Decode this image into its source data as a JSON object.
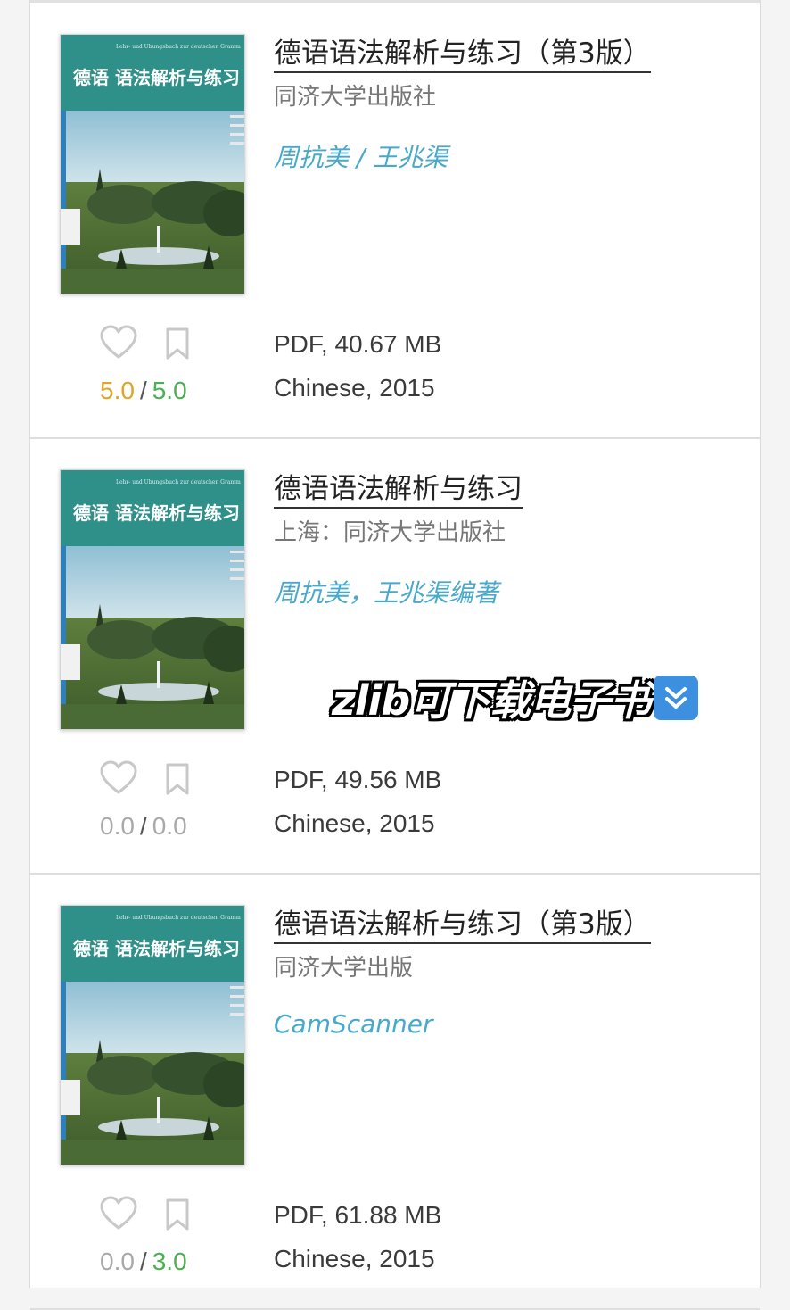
{
  "colors": {
    "author": "#49a9cb",
    "rating_high": "#e0a526",
    "rating_green": "#4caf50",
    "rating_zero": "#a9a9a9",
    "cover_teal": "#2e8f8a"
  },
  "icons": {
    "like": "heart-icon",
    "save": "bookmark-icon",
    "overlay": "double-down-arrow-icon"
  },
  "books": [
    {
      "title": "德语语法解析与练习（第3版）",
      "publisher": "同济大学出版社",
      "author": "周抗美 / 王兆渠",
      "format_size": "PDF, 40.67 MB",
      "language_year": "Chinese, 2015",
      "rating_left": "5.0",
      "rating_right": "5.0",
      "rating_left_color": "#e0a526",
      "rating_right_color": "#4caf50",
      "cover_title": "德语 语法解析与练习",
      "cover_subtitle": "Lehr- und Übungsbuch zur deutschen Grammatik"
    },
    {
      "title": "德语语法解析与练习",
      "publisher": "上海：同济大学出版社",
      "author": "周抗美，王兆渠编著",
      "format_size": "PDF, 49.56 MB",
      "language_year": "Chinese, 2015",
      "rating_left": "0.0",
      "rating_right": "0.0",
      "rating_left_color": "#a9a9a9",
      "rating_right_color": "#a9a9a9",
      "cover_title": "德语 语法解析与练习",
      "cover_subtitle": "Lehr- und Übungsbuch zur deutschen Grammatik"
    },
    {
      "title": "德语语法解析与练习（第3版）",
      "publisher": "同济大学出版",
      "author": "CamScanner",
      "format_size": "PDF, 61.88 MB",
      "language_year": "Chinese, 2015",
      "rating_left": "0.0",
      "rating_right": "3.0",
      "rating_left_color": "#a9a9a9",
      "rating_right_color": "#4caf50",
      "cover_title": "德语 语法解析与练习",
      "cover_subtitle": "Lehr- und Übungsbuch zur deutschen Grammatik"
    }
  ],
  "overlay": {
    "text": "zlib可下载电子书"
  }
}
